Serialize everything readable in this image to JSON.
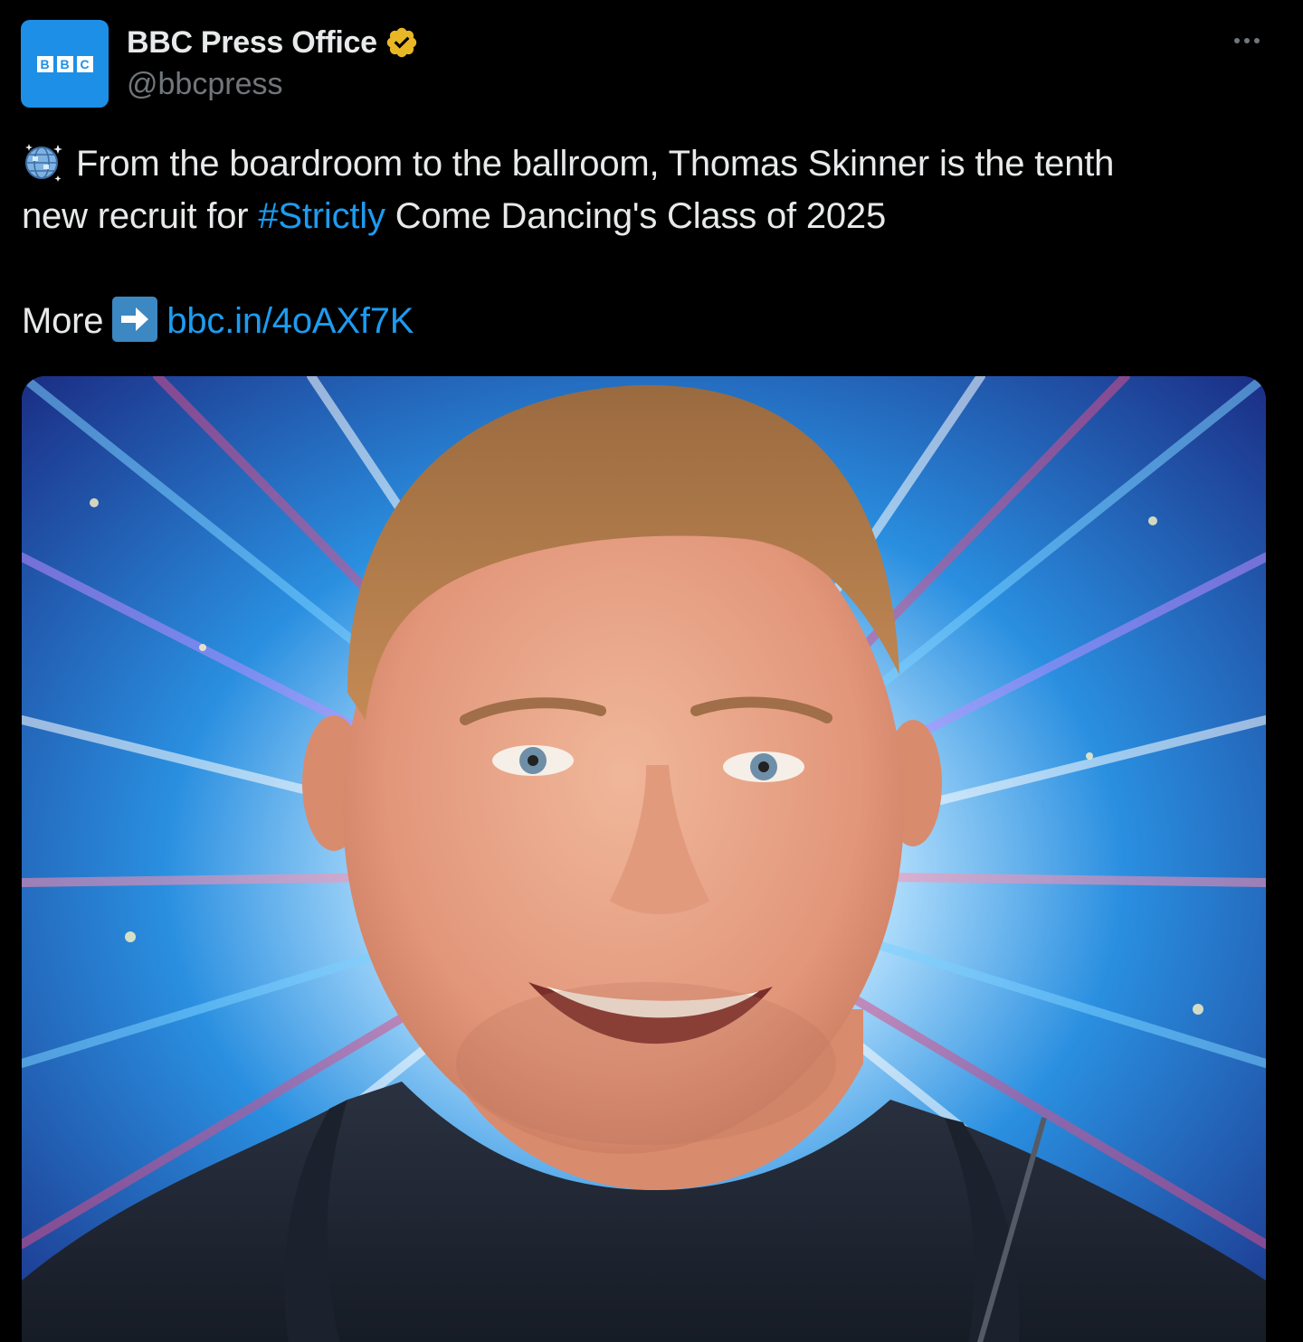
{
  "account": {
    "display_name": "BBC Press Office",
    "handle": "@bbcpress",
    "avatar_letters": [
      "B",
      "B",
      "C"
    ],
    "verified": true,
    "verified_color": "#e8b725"
  },
  "post": {
    "line1_text": "From the boardroom to the ballroom, Thomas Skinner is the tenth",
    "line2_prefix": "new recruit for ",
    "hashtag": "#Strictly",
    "line2_suffix": " Come Dancing's Class of 2025",
    "more_label": "More",
    "link_text": "bbc.in/4oAXf7K",
    "leading_emoji": "mirror-ball-icon",
    "arrow_emoji": "right-arrow-icon"
  },
  "colors": {
    "background": "#000000",
    "text": "#e7e9ea",
    "secondary_text": "#71767b",
    "link": "#1d9bf0",
    "avatar_bg": "#1d8fe6"
  }
}
